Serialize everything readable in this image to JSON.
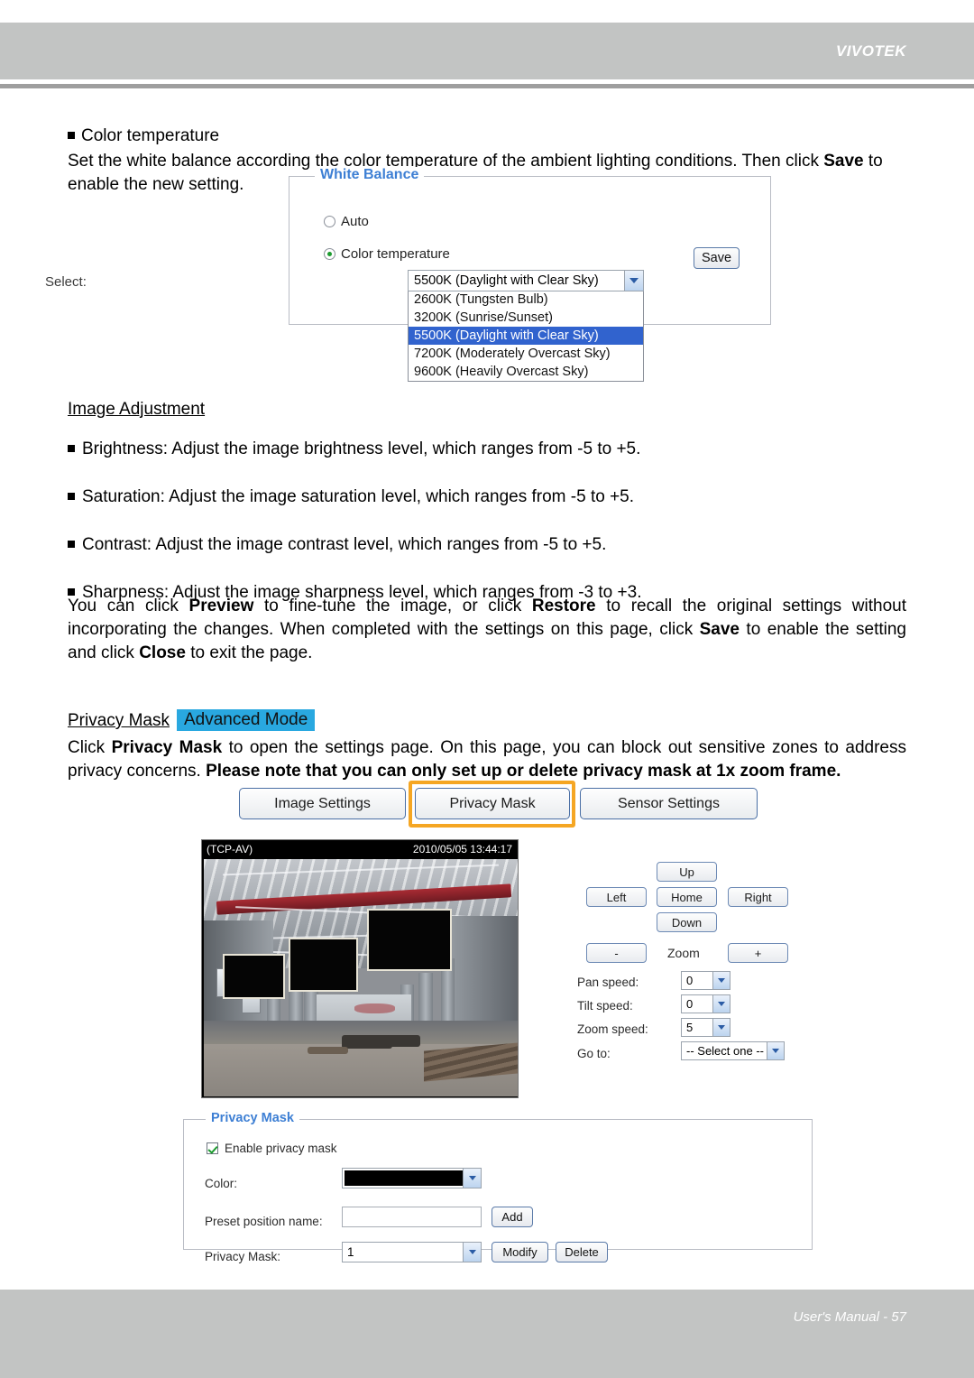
{
  "header": {
    "brand": "VIVOTEK"
  },
  "footer": {
    "folio": "User's Manual - 57"
  },
  "color_temperature": {
    "bullet_title": "Color temperature",
    "description_part1": "Set the white balance according the color temperature of the ambient lighting conditions. Then click ",
    "description_bold": "Save",
    "description_part2": " to enable the new setting."
  },
  "white_balance": {
    "legend": "White Balance",
    "auto_label": "Auto",
    "color_temp_label": "Color temperature",
    "select_label": "Select:",
    "selected_value": "5500K (Daylight with Clear Sky)",
    "options": [
      "2600K (Tungsten Bulb)",
      "3200K (Sunrise/Sunset)",
      "5500K (Daylight with Clear Sky)",
      "7200K (Moderately Overcast Sky)",
      "9600K (Heavily Overcast Sky)"
    ],
    "selected_index": 2,
    "save_label": "Save",
    "highlight_color": "#3163ce",
    "legend_color": "#3d7fd4"
  },
  "image_adjustment": {
    "heading": "Image Adjustment",
    "bullets": [
      "Brightness: Adjust the image brightness level, which ranges from -5 to +5.",
      "Saturation: Adjust the image saturation level, which ranges from -5 to +5.",
      "Contrast: Adjust the image contrast level, which ranges from -5 to +5.",
      "Sharpness: Adjust the image sharpness level, which ranges from -3 to +3."
    ],
    "paragraph": {
      "p1": "You can click ",
      "b1": "Preview",
      "p2": " to fine-tune the image, or click ",
      "b2": "Restore",
      "p3": " to recall the original settings without incorporating the changes. When completed with the settings on this page, click ",
      "b3": "Save",
      "p4": " to enable the setting and click ",
      "b4": "Close",
      "p5": " to exit the page."
    }
  },
  "privacy_mask_section": {
    "link_label": "Privacy Mask",
    "badge_label": "Advanced Mode",
    "badge_color": "#29a8e0",
    "paragraph": {
      "p1": "Click ",
      "b1": "Privacy Mask",
      "p2": " to open the settings page. On this page, you can block out sensitive zones to address privacy concerns. ",
      "b2": "Please note that you can only set up or delete privacy mask at 1x zoom frame."
    }
  },
  "tabs": {
    "items": [
      {
        "label": "Image Settings",
        "active": false
      },
      {
        "label": "Privacy Mask",
        "active": true
      },
      {
        "label": "Sensor Settings",
        "active": false
      }
    ],
    "highlight_color": "#f5a623"
  },
  "camera_view": {
    "stream_label": "(TCP-AV)",
    "timestamp": "2010/05/05 13:44:17",
    "mask_count": 3
  },
  "ptz": {
    "up": "Up",
    "left": "Left",
    "home": "Home",
    "right": "Right",
    "down": "Down",
    "zoom_out": "-",
    "zoom_label": "Zoom",
    "zoom_in": "+",
    "pan_speed_label": "Pan speed:",
    "pan_speed_value": "0",
    "tilt_speed_label": "Tilt speed:",
    "tilt_speed_value": "0",
    "zoom_speed_label": "Zoom speed:",
    "zoom_speed_value": "5",
    "goto_label": "Go to:",
    "goto_value": "-- Select one --"
  },
  "privacy_mask_panel": {
    "legend": "Privacy Mask",
    "enable_label": "Enable privacy mask",
    "enable_checked": true,
    "color_label": "Color:",
    "color_value": "#000000",
    "preset_label": "Preset position name:",
    "preset_value": "",
    "add_label": "Add",
    "mask_label": "Privacy Mask:",
    "mask_value": "1",
    "modify_label": "Modify",
    "delete_label": "Delete"
  }
}
